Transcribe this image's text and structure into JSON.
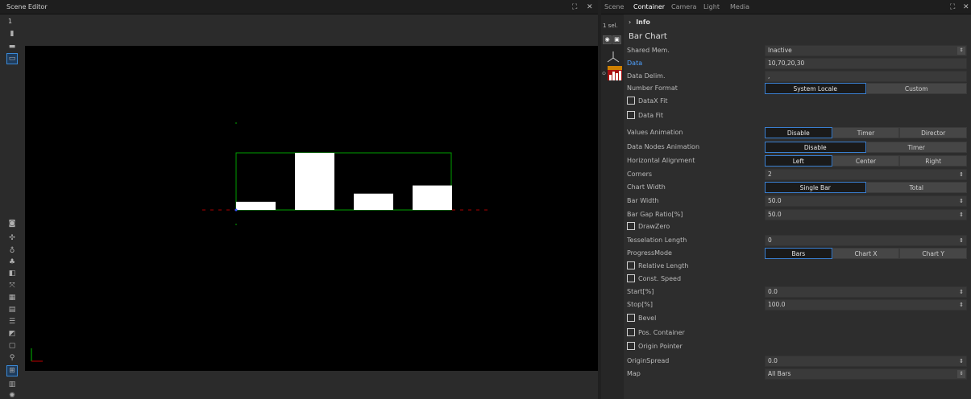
{
  "scene_editor": {
    "tab_title": "Scene Editor",
    "expand_icon": "⛶",
    "close_icon": "✕",
    "view_number": "1"
  },
  "properties": {
    "tabs": [
      {
        "label": "Scene",
        "active": false
      },
      {
        "label": "Container",
        "active": true
      },
      {
        "label": "Camera",
        "active": false
      },
      {
        "label": "Light",
        "active": false
      },
      {
        "label": "Media",
        "active": false
      }
    ],
    "selection_count": "1 sel.",
    "info_label": "Info",
    "plugin_title": "Bar Chart",
    "fields": {
      "shared_mem": {
        "label": "Shared Mem.",
        "value": "Inactive"
      },
      "data": {
        "label": "Data",
        "value": "10,70,20,30"
      },
      "data_delim": {
        "label": "Data Delim.",
        "value": ","
      },
      "number_format": {
        "label": "Number Format",
        "options": [
          "System Locale",
          "Custom"
        ],
        "selected": 0
      },
      "datax_fit": {
        "label": "DataX Fit"
      },
      "data_fit": {
        "label": "Data Fit"
      },
      "values_animation": {
        "label": "Values Animation",
        "options": [
          "Disable",
          "Timer",
          "Director"
        ],
        "selected": 0
      },
      "data_nodes_animation": {
        "label": "Data Nodes Animation",
        "options": [
          "Disable",
          "Timer"
        ],
        "selected": 0
      },
      "horizontal_alignment": {
        "label": "Horizontal Alignment",
        "options": [
          "Left",
          "Center",
          "Right"
        ],
        "selected": 0
      },
      "corners": {
        "label": "Corners",
        "value": "2"
      },
      "chart_width": {
        "label": "Chart Width",
        "options": [
          "Single Bar",
          "Total"
        ],
        "selected": 0
      },
      "bar_width": {
        "label": "Bar Width",
        "value": "50.0"
      },
      "bar_gap_ratio": {
        "label": "Bar Gap Ratio[%]",
        "value": "50.0"
      },
      "draw_zero": {
        "label": "DrawZero"
      },
      "tesselation_length": {
        "label": "Tesselation Length",
        "value": "0"
      },
      "progress_mode": {
        "label": "ProgressMode",
        "options": [
          "Bars",
          "Chart X",
          "Chart Y"
        ],
        "selected": 0
      },
      "relative_length": {
        "label": "Relative Length"
      },
      "const_speed": {
        "label": "Const. Speed"
      },
      "start": {
        "label": "Start[%]",
        "value": "0.0"
      },
      "stop": {
        "label": "Stop[%]",
        "value": "100.0"
      },
      "bevel": {
        "label": "Bevel"
      },
      "pos_container": {
        "label": "Pos. Container"
      },
      "origin_pointer": {
        "label": "Origin Pointer"
      },
      "origin_spread": {
        "label": "OriginSpread",
        "value": "0.0"
      },
      "map": {
        "label": "Map",
        "value": "All Bars"
      }
    }
  },
  "chart_data": {
    "type": "bar",
    "values": [
      10,
      70,
      20,
      30
    ],
    "ylim": [
      0,
      70
    ]
  }
}
